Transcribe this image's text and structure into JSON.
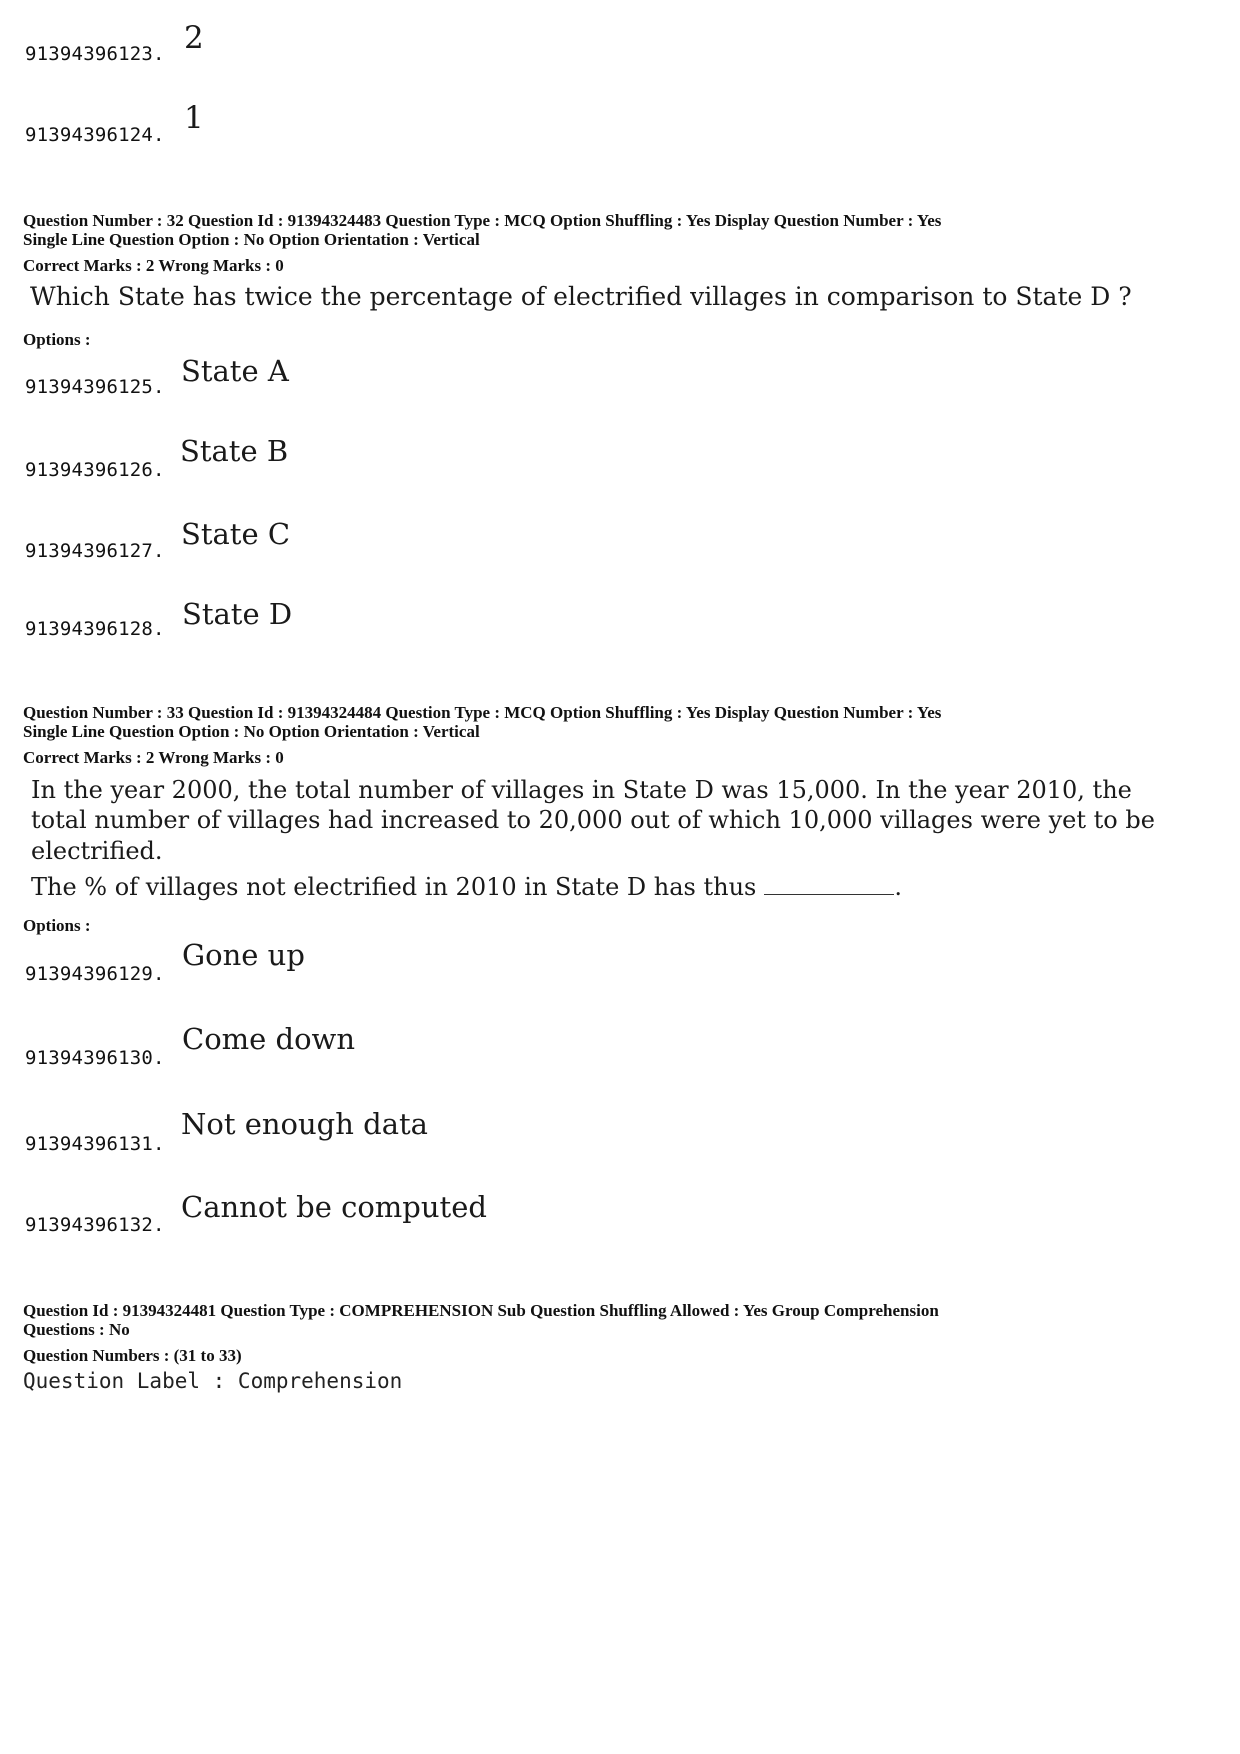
{
  "prev_question_options": [
    {
      "id": "91394396123.",
      "text": "2"
    },
    {
      "id": "91394396124.",
      "text": "1"
    }
  ],
  "q32": {
    "meta_line1": "Question Number : 32  Question Id : 91394324483  Question Type : MCQ  Option Shuffling : Yes  Display Question Number : Yes",
    "meta_line2": "Single Line Question Option : No  Option Orientation : Vertical",
    "marks": "Correct Marks : 2  Wrong Marks : 0",
    "question": "Which State has twice the percentage of electrified villages in comparison to State D ?",
    "options_label": "Options :",
    "options": [
      {
        "id": "91394396125.",
        "text": "State  A"
      },
      {
        "id": "91394396126.",
        "text": "State  B"
      },
      {
        "id": "91394396127.",
        "text": "State  C"
      },
      {
        "id": "91394396128.",
        "text": "State  D"
      }
    ]
  },
  "q33": {
    "meta_line1": "Question Number : 33  Question Id : 91394324484  Question Type : MCQ  Option Shuffling : Yes  Display Question Number : Yes",
    "meta_line2": "Single Line Question Option : No  Option Orientation : Vertical",
    "marks": "Correct Marks : 2  Wrong Marks : 0",
    "question_para1_line1": "In the year 2000, the total number of villages in State D was 15,000.  In the year 2010, the",
    "question_para1_line2": "total number of villages had increased to 20,000 out of which 10,000 villages were yet to be",
    "question_para1_line3": "electrified.",
    "question_para2": "The % of villages not electrified in 2010 in State D has thus",
    "question_para2_end": ".",
    "options_label": "Options :",
    "options": [
      {
        "id": "91394396129.",
        "text": "Gone up"
      },
      {
        "id": "91394396130.",
        "text": "Come down"
      },
      {
        "id": "91394396131.",
        "text": "Not enough data"
      },
      {
        "id": "91394396132.",
        "text": "Cannot be computed"
      }
    ]
  },
  "comprehension": {
    "meta_line1": "Question Id : 91394324481  Question Type : COMPREHENSION  Sub Question Shuffling Allowed : Yes  Group Comprehension",
    "meta_line2": "Questions : No",
    "question_numbers": "Question Numbers : (31 to 33)",
    "question_label": "Question Label : Comprehension"
  }
}
